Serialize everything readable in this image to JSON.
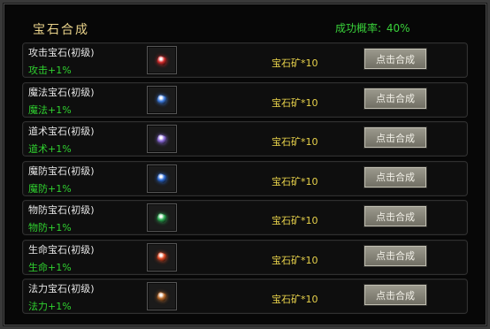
{
  "header": {
    "title": "宝石合成",
    "success_label": "成功概率:",
    "success_value": "40%"
  },
  "items": [
    {
      "name": "攻击宝石(初级)",
      "effect": "攻击+1%",
      "gem_color": "#d12b2b",
      "requirement": "宝石矿*10",
      "button": "点击合成",
      "icon": "red-gem-icon"
    },
    {
      "name": "魔法宝石(初级)",
      "effect": "魔法+1%",
      "gem_color": "#3f7de0",
      "requirement": "宝石矿*10",
      "button": "点击合成",
      "icon": "blue-gem-icon"
    },
    {
      "name": "道术宝石(初级)",
      "effect": "道术+1%",
      "gem_color": "#8a6ad8",
      "requirement": "宝石矿*10",
      "button": "点击合成",
      "icon": "purple-gem-icon"
    },
    {
      "name": "魔防宝石(初级)",
      "effect": "魔防+1%",
      "gem_color": "#2f6dd6",
      "requirement": "宝石矿*10",
      "button": "点击合成",
      "icon": "dark-blue-gem-icon"
    },
    {
      "name": "物防宝石(初级)",
      "effect": "物防+1%",
      "gem_color": "#2fae55",
      "requirement": "宝石矿*10",
      "button": "点击合成",
      "icon": "green-gem-icon"
    },
    {
      "name": "生命宝石(初级)",
      "effect": "生命+1%",
      "gem_color": "#e04a24",
      "requirement": "宝石矿*10",
      "button": "点击合成",
      "icon": "orange-red-gem-icon"
    },
    {
      "name": "法力宝石(初级)",
      "effect": "法力+1%",
      "gem_color": "#b86a2b",
      "requirement": "宝石矿*10",
      "button": "点击合成",
      "icon": "brown-gem-icon"
    }
  ]
}
